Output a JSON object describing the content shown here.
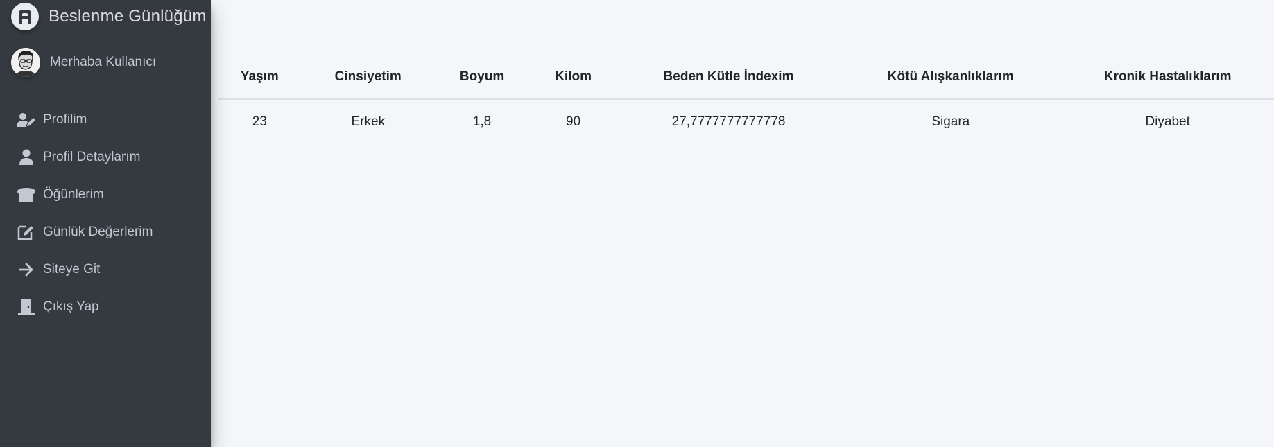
{
  "brand": {
    "name": "Beslenme Günlüğüm"
  },
  "user": {
    "greeting": "Merhaba Kullanıcı"
  },
  "sidebar": {
    "items": [
      {
        "label": "Profilim",
        "icon": "user-edit-icon"
      },
      {
        "label": "Profil Detaylarım",
        "icon": "user-icon"
      },
      {
        "label": "Öğünlerim",
        "icon": "bread-icon"
      },
      {
        "label": "Günlük Değerlerim",
        "icon": "edit-icon"
      },
      {
        "label": "Siteye Git",
        "icon": "arrow-right-icon"
      },
      {
        "label": "Çıkış Yap",
        "icon": "door-exit-icon"
      }
    ]
  },
  "table": {
    "headers": [
      "Yaşım",
      "Cinsiyetim",
      "Boyum",
      "Kilom",
      "Beden Kütle İndexim",
      "Kötü Alışkanlıklarım",
      "Kronik Hastalıklarım"
    ],
    "rows": [
      [
        "23",
        "Erkek",
        "1,8",
        "90",
        "27,7777777777778",
        "Sigara",
        "Diyabet"
      ]
    ]
  },
  "colors": {
    "sidebar_bg": "#343a40",
    "content_bg": "#f4f6f9",
    "sidebar_text": "#c2c7d0"
  }
}
